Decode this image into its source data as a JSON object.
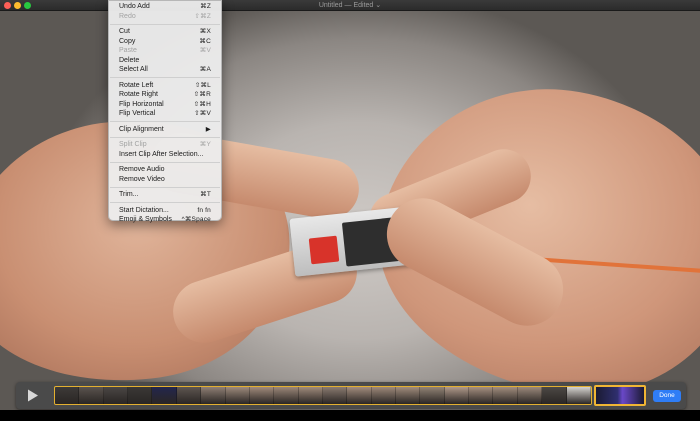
{
  "window": {
    "title": "Untitled — Edited ⌄"
  },
  "menu": {
    "groups": [
      [
        {
          "label": "Undo Add",
          "shortcut": "⌘Z",
          "enabled": true
        },
        {
          "label": "Redo",
          "shortcut": "⇧⌘Z",
          "enabled": false
        }
      ],
      [
        {
          "label": "Cut",
          "shortcut": "⌘X",
          "enabled": true
        },
        {
          "label": "Copy",
          "shortcut": "⌘C",
          "enabled": true
        },
        {
          "label": "Paste",
          "shortcut": "⌘V",
          "enabled": false
        },
        {
          "label": "Delete",
          "shortcut": "",
          "enabled": true
        },
        {
          "label": "Select All",
          "shortcut": "⌘A",
          "enabled": true
        }
      ],
      [
        {
          "label": "Rotate Left",
          "shortcut": "⇧⌘L",
          "enabled": true
        },
        {
          "label": "Rotate Right",
          "shortcut": "⇧⌘R",
          "enabled": true
        },
        {
          "label": "Flip Horizontal",
          "shortcut": "⇧⌘H",
          "enabled": true
        },
        {
          "label": "Flip Vertical",
          "shortcut": "⇧⌘V",
          "enabled": true
        }
      ],
      [
        {
          "label": "Clip Alignment",
          "shortcut": "▶",
          "enabled": true
        }
      ],
      [
        {
          "label": "Split Clip",
          "shortcut": "⌘Y",
          "enabled": false
        },
        {
          "label": "Insert Clip After Selection...",
          "shortcut": "",
          "enabled": true
        }
      ],
      [
        {
          "label": "Remove Audio",
          "shortcut": "",
          "enabled": true
        },
        {
          "label": "Remove Video",
          "shortcut": "",
          "enabled": true
        }
      ],
      [
        {
          "label": "Trim...",
          "shortcut": "⌘T",
          "enabled": true
        }
      ],
      [
        {
          "label": "Start Dictation...",
          "shortcut": "fn fn",
          "enabled": true
        },
        {
          "label": "Emoji & Symbols",
          "shortcut": "^⌘Space",
          "enabled": true
        }
      ]
    ]
  },
  "trim": {
    "play_icon": "play-icon",
    "done_label": "Done",
    "accent": "#f0b534",
    "done_color": "#2f7df6",
    "thumbnails": [
      "#3d3a38",
      "#5a534e",
      "#4a4644",
      "#3a3836",
      "#23264d",
      "#5d5550",
      "#8f7f74",
      "#9d8a7c",
      "#a08a7b",
      "#9b8778",
      "#9f8b7b",
      "#8a7b70",
      "#a28c7d",
      "#9d897a",
      "#a08c7c",
      "#928375",
      "#b0998a",
      "#a58f80",
      "#a28d7e",
      "#9b897b",
      "#4c4845",
      "#d5d3d0"
    ]
  }
}
